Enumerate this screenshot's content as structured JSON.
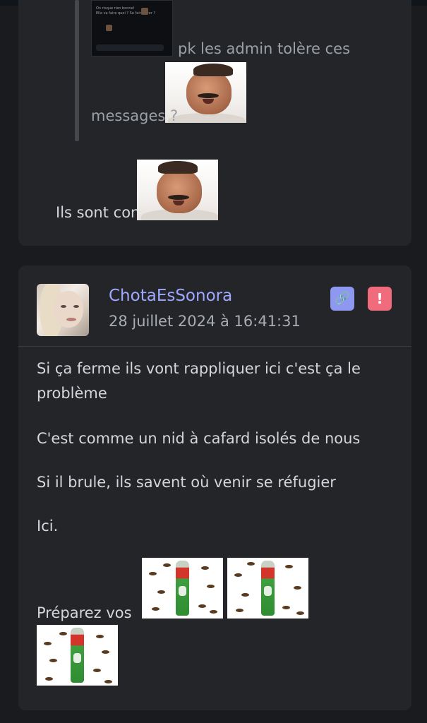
{
  "quote": {
    "screenshot_text": "On risque rien bonne!\nElle va faire quoi ? Se faire virer ?",
    "line1": "pk les admin tolère ces",
    "line2": "messages ?"
  },
  "reply1": {
    "text": "Ils sont cons"
  },
  "post": {
    "username": "ChotaEsSonora",
    "timestamp": "28 juillet 2024 à 16:41:31",
    "link_icon": "🔗",
    "report_icon": "!",
    "paragraphs": [
      "Si ça ferme ils vont rappliquer ici c'est ça le problème",
      "C'est comme un nid à cafard isolés de nous",
      "Si il brule, ils savent où venir se réfugier",
      "Ici.",
      "Préparez vos"
    ],
    "spray_label": "Baygon"
  },
  "colors": {
    "background": "#1a1b1e",
    "card": "#242529",
    "username": "#9fa8ff",
    "link_button": "#8e98f0",
    "report_button": "#f06b7c"
  }
}
